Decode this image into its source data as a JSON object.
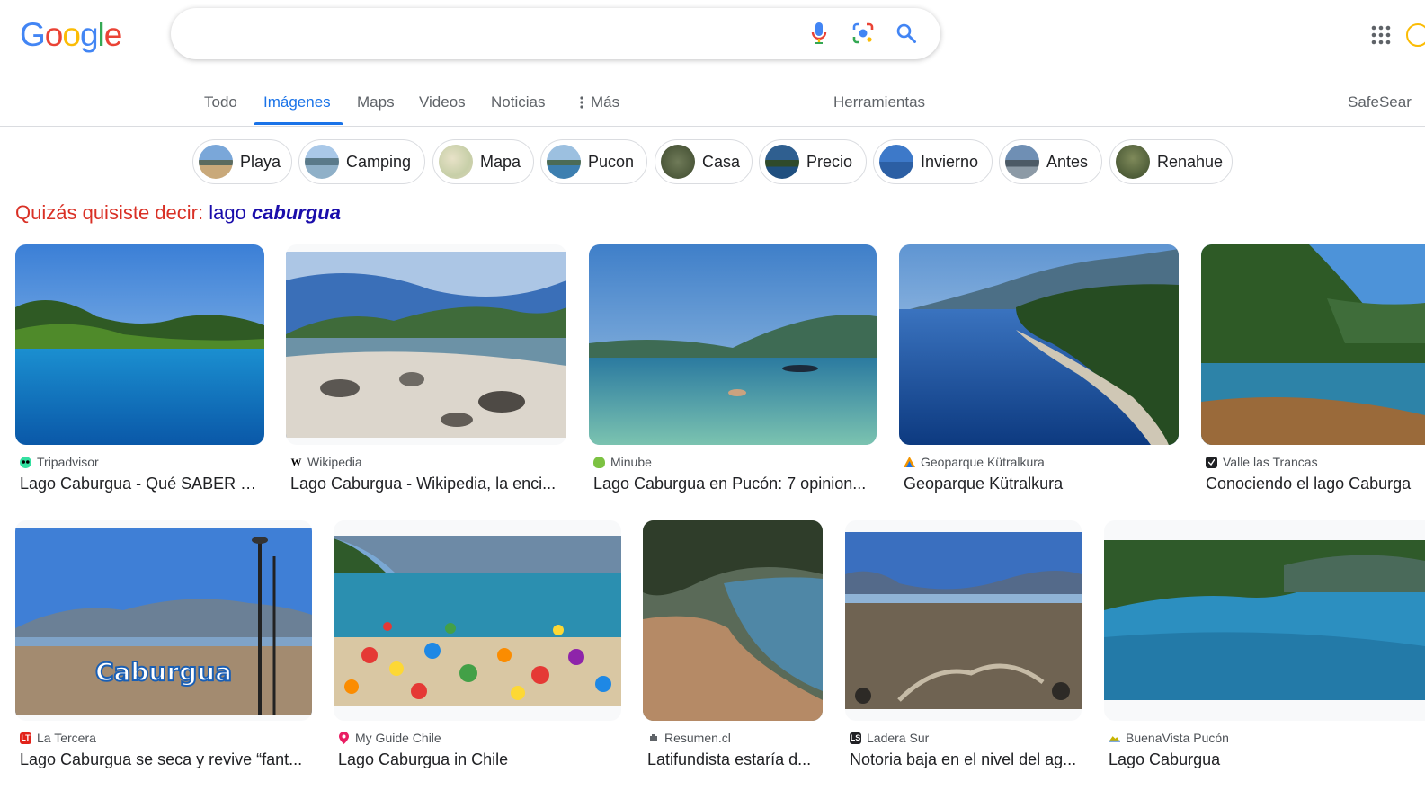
{
  "logo": {
    "letters": [
      "G",
      "o",
      "o",
      "g",
      "l",
      "e"
    ],
    "colors": [
      "#4285f4",
      "#ea4335",
      "#fbbc05",
      "#4285f4",
      "#34a853",
      "#ea4335"
    ]
  },
  "search": {
    "value": "",
    "icons": [
      "microphone-icon",
      "camera-lens-icon",
      "search-icon"
    ]
  },
  "tabs": {
    "items": [
      "Todo",
      "Imágenes",
      "Maps",
      "Videos",
      "Noticias",
      "Más"
    ],
    "active": "Imágenes",
    "more_icon": "vertical-dots-icon",
    "tools": "Herramientas",
    "safesearch": "SafeSear"
  },
  "chips": [
    "Playa",
    "Camping",
    "Mapa",
    "Pucon",
    "Casa",
    "Precio",
    "Invierno",
    "Antes",
    "Renahue"
  ],
  "spelling": {
    "prefix": "Quizás quisiste decir:",
    "plain": "lago",
    "bold": "caburgua"
  },
  "results_row1": [
    {
      "source": "Tripadvisor",
      "title": "Lago Caburgua - Qué SABER a...",
      "favicon_color": "#34e0a1"
    },
    {
      "source": "Wikipedia",
      "title": "Lago Caburgua - Wikipedia, la enci...",
      "favicon_color": "#ffffff"
    },
    {
      "source": "Minube",
      "title": "Lago Caburgua en Pucón: 7 opinion...",
      "favicon_color": "#7cc242"
    },
    {
      "source": "Geoparque Kütralkura",
      "title": "Geoparque Kütralkura",
      "favicon_color": "#f29400"
    },
    {
      "source": "Valle las Trancas",
      "title": "Conociendo el lago Caburga",
      "favicon_color": "#202124"
    }
  ],
  "results_row2": [
    {
      "source": "La Tercera",
      "title": "Lago Caburgua se seca y revive “fant...",
      "favicon_color": "#e2231a",
      "image_text": "Caburgua"
    },
    {
      "source": "My Guide Chile",
      "title": "Lago Caburgua in Chile",
      "favicon_color": "#e91e63"
    },
    {
      "source": "Resumen.cl",
      "title": "Latifundista estaría d...",
      "favicon_color": "#5f6368"
    },
    {
      "source": "Ladera Sur",
      "title": "Notoria baja en el nivel del ag...",
      "favicon_color": "#202124"
    },
    {
      "source": "BuenaVista Pucón",
      "title": "Lago Caburgua",
      "favicon_color": "#c8b400"
    }
  ]
}
